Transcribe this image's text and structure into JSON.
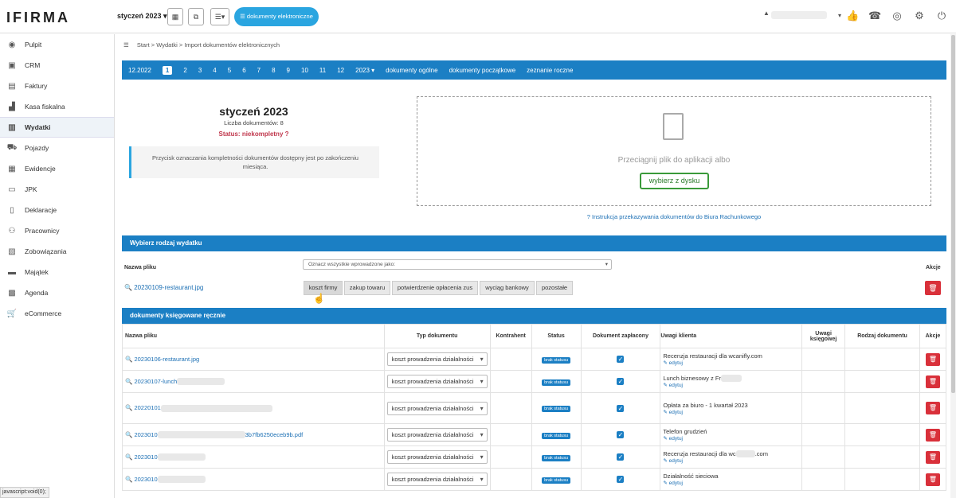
{
  "topbar": {
    "logo": "IFIRMA",
    "month": "styczeń 2023",
    "edocs_label": "dokumenty elektroniczne"
  },
  "sidebar": {
    "items": [
      {
        "label": "Pulpit",
        "icon": "dashboard-icon"
      },
      {
        "label": "CRM",
        "icon": "crm-icon"
      },
      {
        "label": "Faktury",
        "icon": "invoice-icon"
      },
      {
        "label": "Kasa fiskalna",
        "icon": "cash-register-icon"
      },
      {
        "label": "Wydatki",
        "icon": "receipt-icon",
        "active": true
      },
      {
        "label": "Pojazdy",
        "icon": "car-icon"
      },
      {
        "label": "Ewidencje",
        "icon": "ledger-icon"
      },
      {
        "label": "JPK",
        "icon": "jpk-icon"
      },
      {
        "label": "Deklaracje",
        "icon": "declaration-icon"
      },
      {
        "label": "Pracownicy",
        "icon": "employees-icon"
      },
      {
        "label": "Zobowiązania",
        "icon": "liabilities-icon"
      },
      {
        "label": "Majątek",
        "icon": "assets-icon"
      },
      {
        "label": "Agenda",
        "icon": "agenda-icon"
      },
      {
        "label": "eCommerce",
        "icon": "cart-icon"
      }
    ]
  },
  "breadcrumb": {
    "items": [
      "Start",
      "Wydatki",
      "Import dokumentów elektronicznych"
    ]
  },
  "monthbar": {
    "prev": "12.2022",
    "months": [
      "1",
      "2",
      "3",
      "4",
      "5",
      "6",
      "7",
      "8",
      "9",
      "10",
      "11",
      "12"
    ],
    "current": "1",
    "year": "2023",
    "links": [
      "dokumenty ogólne",
      "dokumenty początkowe",
      "zeznanie roczne"
    ]
  },
  "summary": {
    "title": "styczeń 2023",
    "count": "Liczba dokumentów: 8",
    "status": "Status: niekompletny",
    "info": "Przycisk oznaczania kompletności dokumentów dostępny jest po zakończeniu miesiąca."
  },
  "dropzone": {
    "text": "Przeciągnij plik do aplikacji albo",
    "button": "wybierz z dysku",
    "help": "Instrukcja przekazywania dokumentów do Biura Rachunkowego"
  },
  "expense_type": {
    "header": "Wybierz rodzaj wydatku",
    "col_file": "Nazwa pliku",
    "col_actions": "Akcje",
    "mark_all": "Oznacz wszystkie wprowadzone jako:",
    "file": "20230109-restaurant.jpg",
    "options": [
      "koszt firmy",
      "zakup towaru",
      "potwierdzenie opłacenia zus",
      "wyciąg bankowy",
      "pozostałe"
    ]
  },
  "manual_docs": {
    "header": "dokumenty księgowane ręcznie",
    "columns": [
      "Nazwa pliku",
      "Typ dokumentu",
      "Kontrahent",
      "Status",
      "Dokument zapłacony",
      "Uwagi klienta",
      "Uwagi księgowej",
      "Rodzaj dokumentu",
      "Akcje"
    ],
    "doc_type": "koszt prowadzenia działalności",
    "status_label": "brak statusu",
    "edit_label": "edytuj",
    "rows": [
      {
        "file": "20230106-restaurant.jpg",
        "note": "Recenzja restauracji dla wcanifly.com"
      },
      {
        "file": "20230107-lunch",
        "note": "Lunch biznesowy z Fr"
      },
      {
        "file": "20220101",
        "note": "Opłata za biuro - 1 kwartał 2023"
      },
      {
        "file": "2023010",
        "file_tail": "3b7fb6250eceb9b.pdf",
        "note": "Telefon grudzień"
      },
      {
        "file": "2023010",
        "note": "Recenzja restauracji dla wc",
        "note_tail": ".com"
      },
      {
        "file": "2023010",
        "note": "Działalność sieciowa"
      }
    ]
  },
  "statusbar": "javascript:void(0);"
}
